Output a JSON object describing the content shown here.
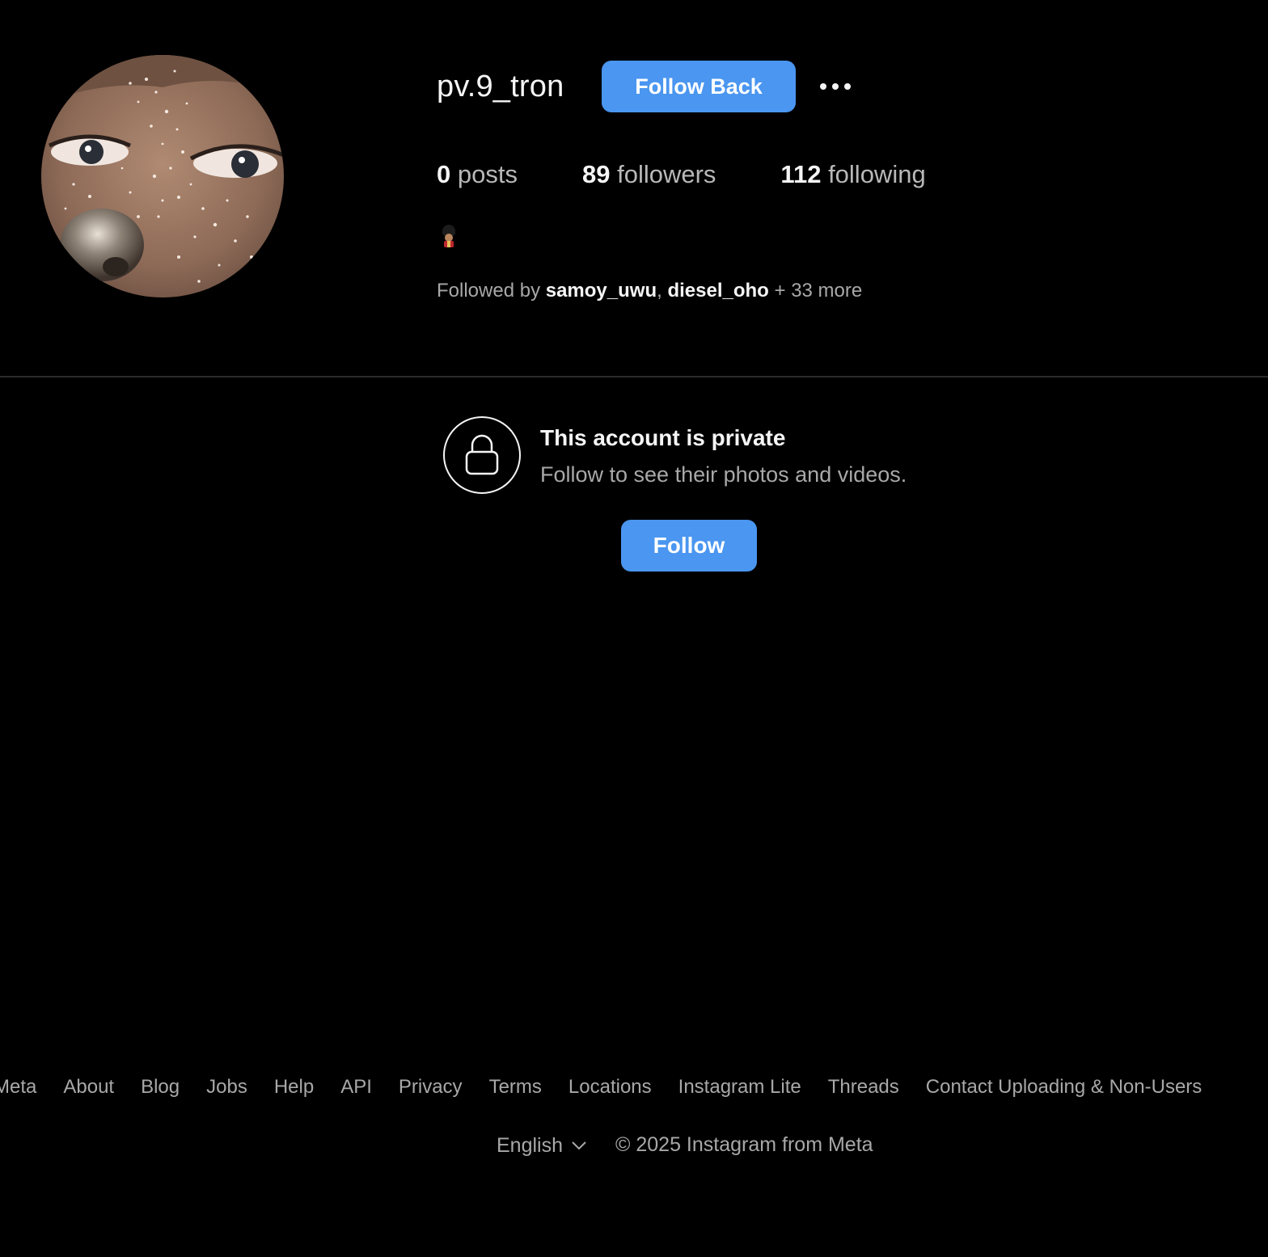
{
  "profile": {
    "username": "pv.9_tron",
    "follow_back_label": "Follow Back",
    "more_options_icon": "more-horizontal-icon",
    "stats": [
      {
        "count": "0",
        "label": "posts"
      },
      {
        "count": "89",
        "label": "followers"
      },
      {
        "count": "112",
        "label": "following"
      }
    ],
    "bio_emoji": "guard-emoji",
    "followed_by": {
      "prefix": "Followed by ",
      "users": [
        "samoy_uwu",
        "diesel_oho"
      ],
      "separator": ", ",
      "suffix": " + 33 more"
    }
  },
  "private_notice": {
    "icon": "lock-icon",
    "title": "This account is private",
    "subtitle": "Follow to see their photos and videos.",
    "follow_label": "Follow"
  },
  "footer": {
    "links": [
      "Meta",
      "About",
      "Blog",
      "Jobs",
      "Help",
      "API",
      "Privacy",
      "Terms",
      "Locations",
      "Instagram Lite",
      "Threads",
      "Contact Uploading & Non-Users"
    ],
    "language": "English",
    "copyright": "© 2025 Instagram from Meta"
  },
  "colors": {
    "background": "#000000",
    "primary_button": "#4a96f0",
    "text_primary": "#f5f5f5",
    "text_secondary": "#a8a8a8",
    "divider": "#2b2b2b"
  }
}
